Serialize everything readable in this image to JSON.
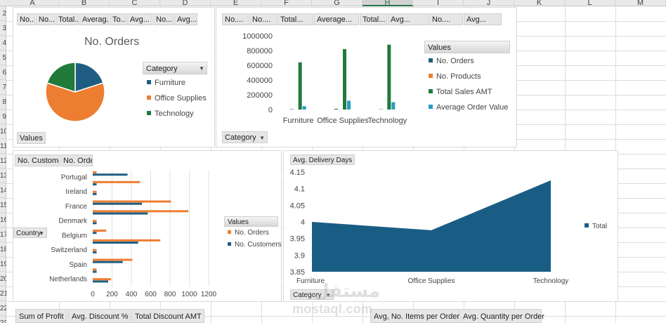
{
  "spreadsheet": {
    "columns": [
      {
        "label": "A",
        "selected": false
      },
      {
        "label": "B",
        "selected": false
      },
      {
        "label": "C",
        "selected": false
      },
      {
        "label": "D",
        "selected": false
      },
      {
        "label": "E",
        "selected": false
      },
      {
        "label": "F",
        "selected": false
      },
      {
        "label": "G",
        "selected": false
      },
      {
        "label": "H",
        "selected": true
      },
      {
        "label": "I",
        "selected": false
      },
      {
        "label": "J",
        "selected": false
      },
      {
        "label": "K",
        "selected": false
      },
      {
        "label": "L",
        "selected": false
      },
      {
        "label": "M",
        "selected": false
      }
    ],
    "rows": [
      "2",
      "3",
      "4",
      "5",
      "6",
      "7",
      "8",
      "9",
      "10",
      "11",
      "12",
      "13",
      "14",
      "15",
      "16",
      "17",
      "18",
      "19",
      "20",
      "21",
      "22",
      "23"
    ]
  },
  "pie_chart": {
    "field_buttons": [
      "No...",
      "No....",
      "Total...",
      "Averag...",
      "To...",
      "Avg...",
      "No....",
      "Avg..."
    ],
    "values_button": "Values",
    "legend_title": "Category"
  },
  "column_chart": {
    "field_buttons": [
      "No....",
      "No....",
      "Total...",
      "Average...",
      "Total...",
      "Avg...",
      "No....",
      "Avg..."
    ],
    "legend_title": "Values",
    "axis_button": "Category"
  },
  "bar_chart": {
    "field_buttons": [
      "No. Customers",
      "No. Orders"
    ],
    "axis_button": "Country",
    "legend_title": "Values"
  },
  "area_chart": {
    "field_button": "Avg. Delivery Days",
    "axis_button": "Category"
  },
  "bottom_buttons_left": [
    "Sum of Profit",
    "Avg. Discount %",
    "Total Discount AMT"
  ],
  "bottom_buttons_right": [
    "Avg, No. Items per Order",
    "Avg. Quantity per Order"
  ],
  "watermark": {
    "arabic": "مستقل",
    "latin": "mostaql.com"
  },
  "chart_data": [
    {
      "type": "pie",
      "title": "No. Orders",
      "categories": [
        "Furniture",
        "Office Supplies",
        "Technology"
      ],
      "values": [
        0.2,
        0.6,
        0.2
      ],
      "colors": [
        "#1f5e82",
        "#ed7d31",
        "#217a3a"
      ]
    },
    {
      "type": "bar",
      "categories": [
        "Furniture",
        "Office Supplies",
        "Technology"
      ],
      "series": [
        {
          "name": "No. Orders",
          "values": [
            5400,
            10000,
            3500
          ],
          "color": "#1f5e82"
        },
        {
          "name": "No. Products",
          "values": [
            380,
            1100,
            400
          ],
          "color": "#ed7d31"
        },
        {
          "name": "Total Sales AMT",
          "values": [
            640000,
            820000,
            880000
          ],
          "color": "#217a3a"
        },
        {
          "name": "Average Order Value",
          "values": [
            45000,
            120000,
            100000
          ],
          "color": "#2b9bc4"
        }
      ],
      "ylim": [
        0,
        1000000
      ],
      "yticks": [
        "0",
        "200000",
        "400000",
        "600000",
        "800000",
        "1000000"
      ],
      "ytick_values": [
        0,
        200000,
        400000,
        600000,
        800000,
        1000000
      ]
    },
    {
      "type": "bar",
      "orientation": "horizontal",
      "categories": [
        "Portugal",
        "Ireland",
        "France",
        "Denmark",
        "Belgium",
        "Switzerland",
        "Spain",
        "Netherlands"
      ],
      "series": [
        {
          "name": "No. Orders",
          "values": [
            40,
            490,
            40,
            810,
            990,
            40,
            140,
            700,
            40,
            410,
            40,
            190
          ],
          "color": "#ed7d31"
        },
        {
          "name": "No. Customers",
          "values": [
            360,
            40,
            40,
            510,
            570,
            40,
            40,
            470,
            40,
            310,
            40,
            160
          ],
          "color": "#1f5e82"
        }
      ],
      "bar_pairs_note": "",
      "xlim": [
        0,
        1200
      ],
      "xticks": [
        "0",
        "200",
        "400",
        "600",
        "800",
        "1000",
        "1200"
      ],
      "xtick_values": [
        0,
        200,
        400,
        600,
        800,
        1000,
        1200
      ]
    },
    {
      "type": "area",
      "categories": [
        "Furniture",
        "Office Supplies",
        "Technology"
      ],
      "series": [
        {
          "name": "Total",
          "values": [
            4.0,
            3.975,
            4.125
          ],
          "color": "#1a5d84"
        }
      ],
      "ylim": [
        3.85,
        4.15
      ],
      "yticks": [
        "3.85",
        "3.9",
        "3.95",
        "4",
        "4.05",
        "4.1",
        "4.15"
      ],
      "ytick_values": [
        3.85,
        3.9,
        3.95,
        4.0,
        4.05,
        4.1,
        4.15
      ]
    }
  ]
}
